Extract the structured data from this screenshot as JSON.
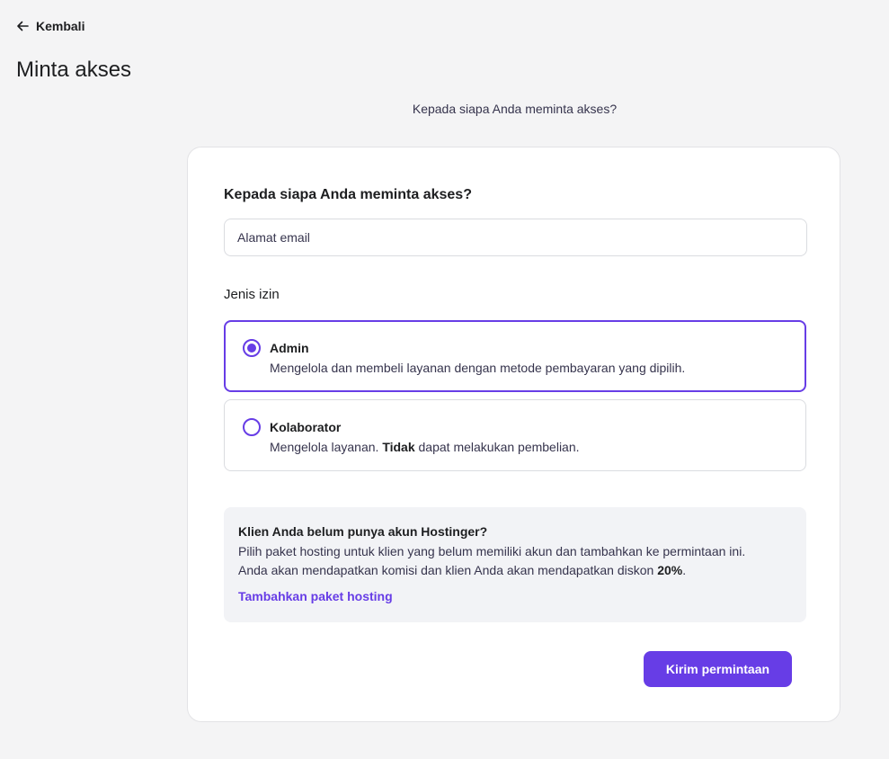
{
  "header": {
    "back_label": "Kembali",
    "back_icon": "arrow-left-icon",
    "page_title": "Minta akses"
  },
  "subtitle": "Kepada siapa Anda meminta akses?",
  "form": {
    "heading": "Kepada siapa Anda meminta akses?",
    "email": {
      "value": "",
      "placeholder": "Alamat email"
    },
    "permission_label": "Jenis izin",
    "options": [
      {
        "title": "Admin",
        "description": "Mengelola dan membeli layanan dengan metode pembayaran yang dipilih.",
        "selected": true
      },
      {
        "title": "Kolaborator",
        "description_before": "Mengelola layanan. ",
        "description_bold": "Tidak",
        "description_after": " dapat melakukan pembelian.",
        "selected": false
      }
    ]
  },
  "info_box": {
    "title": "Klien Anda belum punya akun Hostinger?",
    "text_line1": "Pilih paket hosting untuk klien yang belum memiliki akun dan tambahkan ke permintaan ini.",
    "text_line2_before": "Anda akan mendapatkan komisi dan klien Anda akan mendapatkan diskon ",
    "text_line2_bold": "20%",
    "text_line2_after": ".",
    "link_label": "Tambahkan paket hosting"
  },
  "submit_label": "Kirim permintaan",
  "colors": {
    "accent": "#673de6",
    "background": "#f4f4f5",
    "card": "#ffffff",
    "info_box": "#f2f3f6"
  }
}
